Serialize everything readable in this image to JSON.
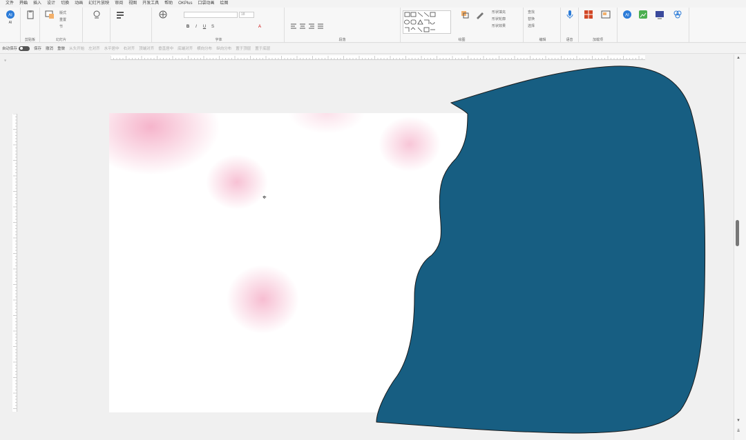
{
  "menu_tabs": [
    "文件",
    "开始",
    "插入",
    "设计",
    "切换",
    "动画",
    "幻灯片放映",
    "审阅",
    "视图",
    "开发工具",
    "帮助",
    "OKPlus",
    "口袋动画",
    "绘图"
  ],
  "active_tab_index": 1,
  "ribbon": {
    "ai_label": "AI",
    "groups": {
      "clipboard": "剪贴板",
      "slides": "幻灯片",
      "font": "字体",
      "paragraph": "段落",
      "drawing": "绘图",
      "editing": "编辑",
      "voice": "语音",
      "addins": "加载项"
    },
    "buttons": {
      "new_slide": "新建幻灯片",
      "layout": "版式",
      "reset": "重置",
      "section": "节",
      "shape_fill": "形状填充",
      "shape_outline": "形状轮廓",
      "shape_effect": "形状效果",
      "find": "查找",
      "replace": "替换",
      "select": "选择",
      "dictate": "听写",
      "designer": "设计器"
    },
    "font_size_placeholder": "18"
  },
  "quickbar": {
    "items": [
      "自动保存",
      "保存",
      "撤消",
      "重做",
      "从头开始",
      "左对齐",
      "水平居中",
      "右对齐",
      "顶端对齐",
      "垂直居中",
      "底端对齐",
      "横向分布",
      "纵向分布",
      "置于顶层",
      "置于底层"
    ]
  },
  "colors": {
    "shape_fill": "#175e82",
    "slide_bg": "#ffffff",
    "blob_pink": "#f4a7c2",
    "ribbon_bg": "#f7f7f7"
  }
}
